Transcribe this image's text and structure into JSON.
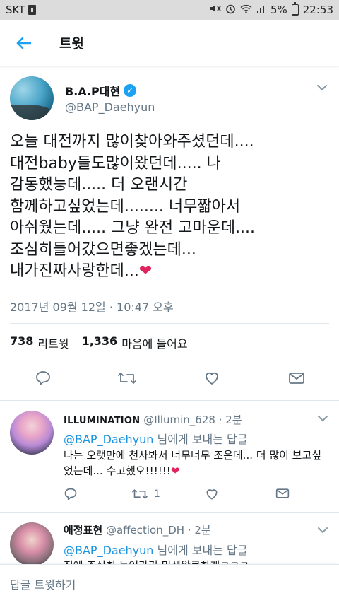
{
  "status_bar": {
    "carrier": "SKT",
    "battery_percent": "5%",
    "battery_level": 0.05,
    "time": "22:53"
  },
  "header": {
    "title": "트윗",
    "back_icon": "back-arrow-icon"
  },
  "tweet": {
    "display_name": "B.A.P대현",
    "verified": true,
    "handle": "@BAP_Daehyun",
    "text": "오늘 대전까지 많이찾아와주셨던데....\n대전baby들도많이왔던데..... 나\n감동했능데..... 더 오랜시간\n함께하고싶었는데........ 너무짧아서\n아쉬웠는데..... 그냥 완전 고마운데....\n조심히들어갔으면좋겠는데...\n내가진짜사랑한데...",
    "heart_emoji": "❤",
    "timestamp": "2017년 09월 12일 · 10:47 오후",
    "retweet_count": "738",
    "retweet_label": "리트윗",
    "like_count": "1,336",
    "like_label": "마음에 들어요"
  },
  "replies": [
    {
      "name": "ILLUMINATION",
      "handle": "@Illumin_628",
      "age": "· 2분",
      "reply_to_mention": "@BAP_Daehyun",
      "reply_to_suffix": " 님에게 보내는 답글",
      "body": "나는 오랫만에 천사봐서 너무너무 조은데... 더 많이 보고싶었는데... 수고했오!!!!!!",
      "body_heart": "❤",
      "retweet_count": "1"
    },
    {
      "name": "애정표현",
      "handle": "@affection_DH",
      "age": "· 2분",
      "reply_to_mention": "@BAP_Daehyun",
      "reply_to_suffix": " 님에게 보내는 답글",
      "body": "진에 조심히 들어가기 미션완료하게ㅋㅋㅋ"
    }
  ],
  "compose": {
    "placeholder": "답글 트윗하기"
  },
  "colors": {
    "accent": "#1da1f2",
    "mention": "#1b95e0",
    "muted": "#657786",
    "heart": "#e0245e"
  }
}
